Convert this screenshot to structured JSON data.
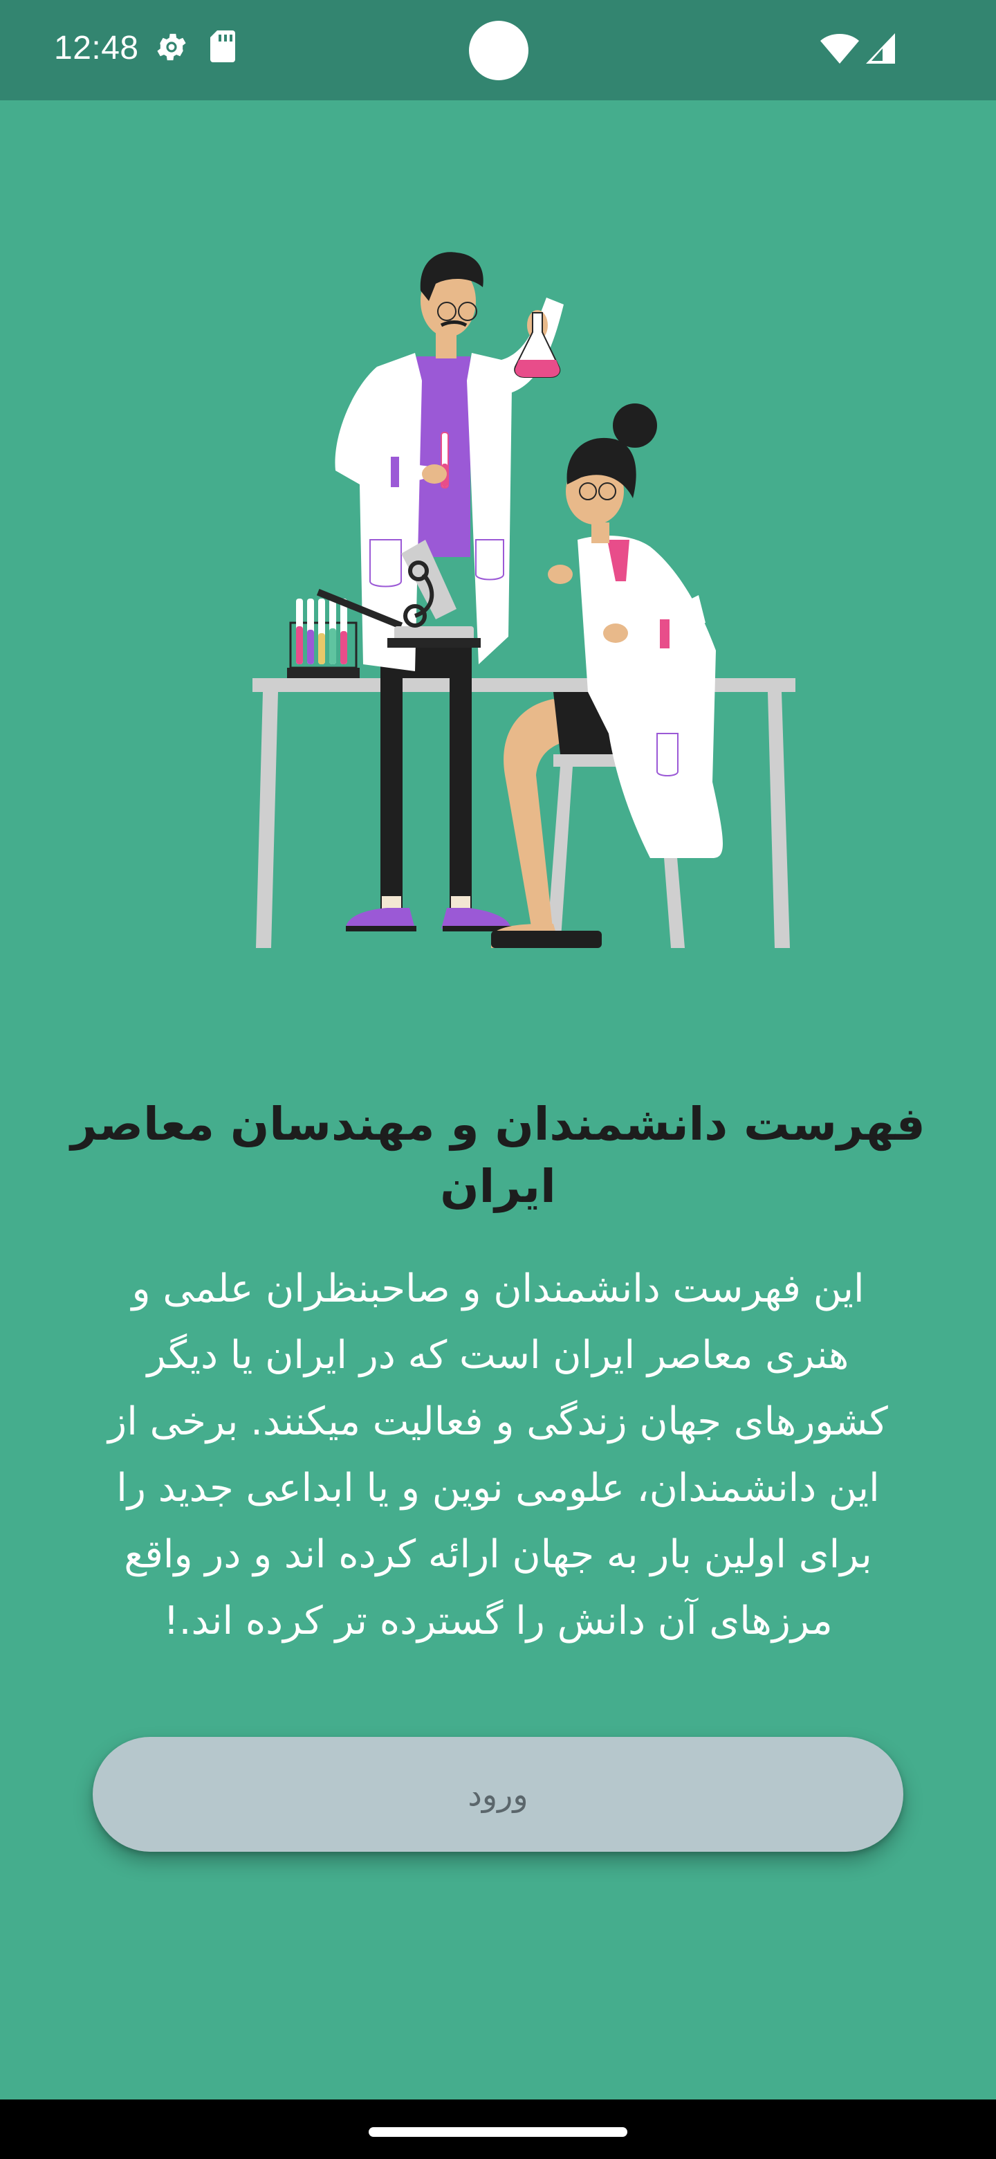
{
  "status_bar": {
    "time": "12:48",
    "icons": [
      "gear-icon",
      "sd-card-icon",
      "wifi-icon",
      "signal-icon"
    ]
  },
  "illustration": {
    "description_icon": "scientists-illustration"
  },
  "main": {
    "title": "فهرست دانشمندان و مهندسان معاصر ایران",
    "description_lines": [
      "این فهرست دانشمندان و صاحبنظران علمی و",
      "هنری معاصر ایران است که در ایران یا دیگر",
      "کشورهای جهان زندگی و فعالیت میکنند. برخی از",
      "این دانشمندان، علومی نوین و یا ابداعی جدید را",
      "برای اولین بار به جهان ارائه کرده اند و در واقع",
      "مرزهای آن دانش را گسترده تر کرده اند.!"
    ],
    "login_button_label": "ورود"
  },
  "colors": {
    "background": "#45ad8d",
    "status_bar": "#338570",
    "button": "#b6c7cc",
    "title_text": "#1d1d1d",
    "body_text": "#ffffff"
  }
}
